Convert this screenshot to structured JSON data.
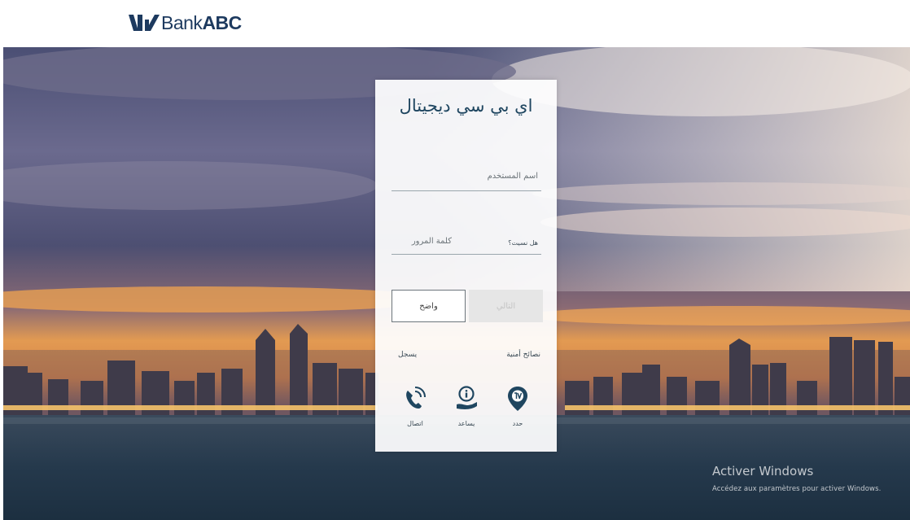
{
  "brand": {
    "name_light": "Bank",
    "name_bold": "ABC",
    "color": "#1d3a5f"
  },
  "login": {
    "title": "اي بي سي ديجيتال",
    "username_placeholder": "اسم المستخدم",
    "password_placeholder": "كلمة المرور",
    "forgot_label": "هل نسيت؟",
    "clear_button": "واضح",
    "next_button": "التالي",
    "security_tips_label": "نصائح أمنية",
    "register_label": "يسجل"
  },
  "quick_links": [
    {
      "label": "حدد",
      "icon": "location-pin-icon"
    },
    {
      "label": "يساعد",
      "icon": "help-hand-icon"
    },
    {
      "label": "اتصال",
      "icon": "phone-call-icon"
    }
  ],
  "watermark": {
    "title": "Activer Windows",
    "subtitle": "Accédez aux paramètres pour activer Windows."
  },
  "colors": {
    "accent": "#1f4660",
    "next_disabled_bg": "#e6e6e6"
  }
}
